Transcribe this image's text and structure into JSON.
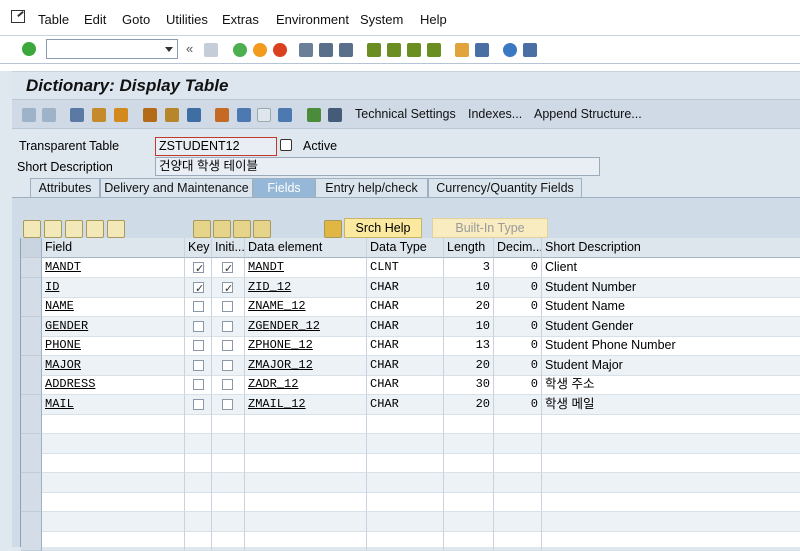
{
  "menu": [
    "Table",
    "Edit",
    "Goto",
    "Utilities",
    "Extras",
    "Environment",
    "System",
    "Help"
  ],
  "window_title": "Dictionary: Display Table",
  "app_toolbar": {
    "technical_settings": "Technical Settings",
    "indexes": "Indexes...",
    "append_structure": "Append Structure..."
  },
  "form": {
    "transparent_table_label": "Transparent Table",
    "table_name": "ZSTUDENT12",
    "status": "Active",
    "short_description_label": "Short Description",
    "short_description": "건양대 학생 테이블"
  },
  "tabs": [
    "Attributes",
    "Delivery and Maintenance",
    "Fields",
    "Entry help/check",
    "Currency/Quantity Fields"
  ],
  "active_tab": "Fields",
  "table_buttons": {
    "srch_help": "Srch Help",
    "built_in_type": "Built-In Type"
  },
  "columns": [
    "Field",
    "Key",
    "Initi...",
    "Data element",
    "Data Type",
    "Length",
    "Decim...",
    "Short Description"
  ],
  "rows": [
    {
      "field": "MANDT",
      "key": true,
      "initial": true,
      "data_element": "MANDT",
      "data_type": "CLNT",
      "length": "3",
      "decimals": "0",
      "description": "Client"
    },
    {
      "field": "ID",
      "key": true,
      "initial": true,
      "data_element": "ZID_12",
      "data_type": "CHAR",
      "length": "10",
      "decimals": "0",
      "description": "Student Number"
    },
    {
      "field": "NAME",
      "key": false,
      "initial": false,
      "data_element": "ZNAME_12",
      "data_type": "CHAR",
      "length": "20",
      "decimals": "0",
      "description": "Student Name"
    },
    {
      "field": "GENDER",
      "key": false,
      "initial": false,
      "data_element": "ZGENDER_12",
      "data_type": "CHAR",
      "length": "10",
      "decimals": "0",
      "description": "Student Gender"
    },
    {
      "field": "PHONE",
      "key": false,
      "initial": false,
      "data_element": "ZPHONE_12",
      "data_type": "CHAR",
      "length": "13",
      "decimals": "0",
      "description": "Student Phone Number"
    },
    {
      "field": "MAJOR",
      "key": false,
      "initial": false,
      "data_element": "ZMAJOR_12",
      "data_type": "CHAR",
      "length": "20",
      "decimals": "0",
      "description": "Student Major"
    },
    {
      "field": "ADDRESS",
      "key": false,
      "initial": false,
      "data_element": "ZADR_12",
      "data_type": "CHAR",
      "length": "30",
      "decimals": "0",
      "description": "학생 주소"
    },
    {
      "field": "MAIL",
      "key": false,
      "initial": false,
      "data_element": "ZMAIL_12",
      "data_type": "CHAR",
      "length": "20",
      "decimals": "0",
      "description": "학생 메일"
    }
  ],
  "colors": {
    "active_tab": "#95b7d8",
    "toolbar_bg": "#cfdae6",
    "button_yellow": "#fbe9a0"
  }
}
